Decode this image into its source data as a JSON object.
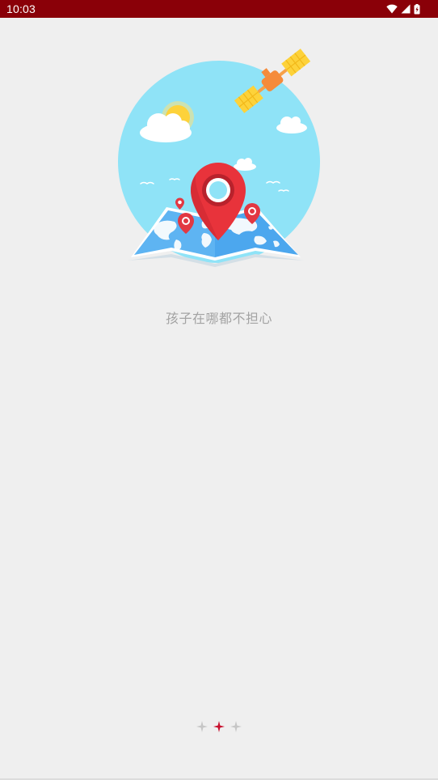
{
  "status_bar": {
    "time": "10:03",
    "icons": [
      "wifi-icon",
      "cellular-signal-icon",
      "battery-charging-icon"
    ],
    "background": "#8a0008"
  },
  "onboarding": {
    "illustration": "map-location-illustration",
    "slogan": "孩子在哪都不担心",
    "page_indicator": {
      "count": 3,
      "active_index": 1,
      "active_color": "#c8102e",
      "inactive_color": "#c6c6c6"
    }
  }
}
